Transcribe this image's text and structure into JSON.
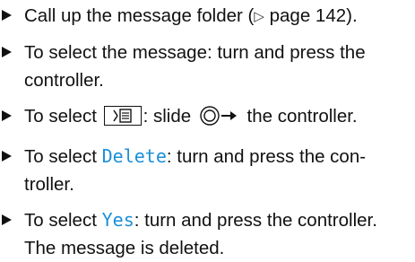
{
  "steps": [
    {
      "parts": {
        "a": "Call up the message folder (",
        "ref_glyph": "▷",
        "b": " page 142)."
      }
    },
    {
      "parts": {
        "a": "To select the message: turn and press the",
        "b": "controller."
      }
    },
    {
      "parts": {
        "a": "To select ",
        "icon": "menu-key-icon",
        "b": ": slide ",
        "c": " the controller."
      }
    },
    {
      "parts": {
        "a": "To select ",
        "hl": "Delete",
        "b": ": turn and press the con-",
        "c": "troller."
      }
    },
    {
      "parts": {
        "a": "To select ",
        "hl": "Yes",
        "b": ": turn and press the controller.",
        "c": "The message is deleted."
      }
    }
  ],
  "colors": {
    "highlight": "#1a8fd8",
    "text": "#111111"
  }
}
